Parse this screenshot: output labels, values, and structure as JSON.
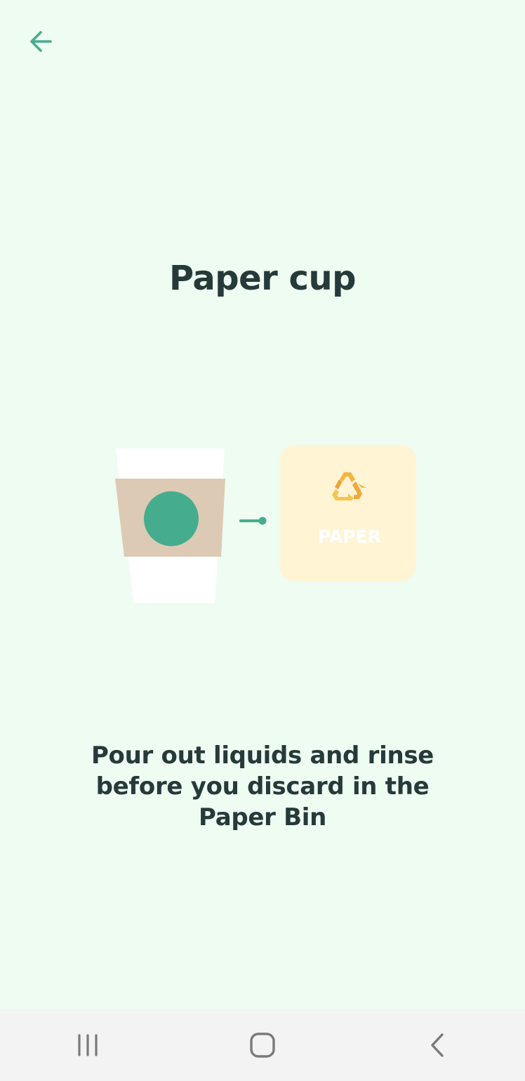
{
  "header": {
    "back_icon": "arrow-left-icon"
  },
  "page": {
    "title": "Paper cup",
    "instruction": "Pour out liquids and rinse before you discard in the Paper Bin"
  },
  "illustration": {
    "item_icon": "paper-cup-icon",
    "connector_icon": "arrow-connector-icon",
    "bin_icon": "recycle-icon",
    "bin_label": "PAPER"
  },
  "colors": {
    "background": "#eefcf2",
    "accent": "#45ad8e",
    "text": "#263a3a",
    "cup_sleeve": "#dccab4",
    "bin_background": "#fff4d4",
    "recycle": "#f3b63f"
  },
  "system_nav": {
    "recents_icon": "recents-icon",
    "home_icon": "home-icon",
    "back_icon": "chevron-left-icon"
  }
}
